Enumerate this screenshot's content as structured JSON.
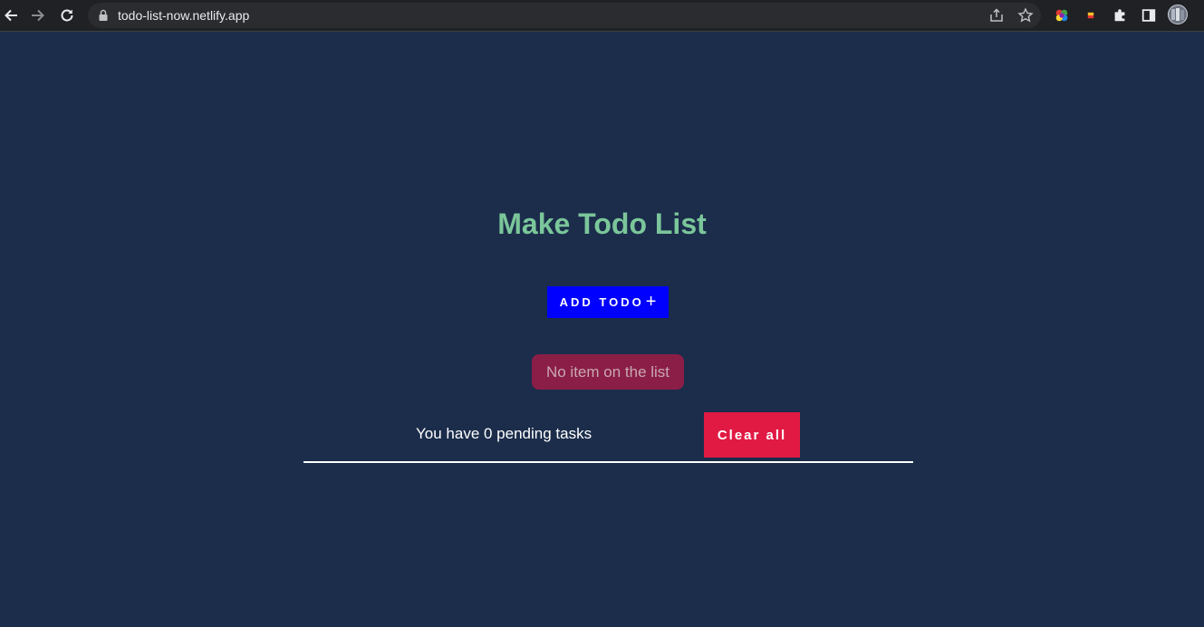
{
  "browser": {
    "url": "todo-list-now.netlify.app",
    "icons": [
      "back-arrow-icon",
      "forward-arrow-icon",
      "reload-icon",
      "lock-icon",
      "share-icon",
      "star-icon",
      "color-wheel-extension-icon",
      "extension-icon",
      "puzzle-icon",
      "side-panel-icon",
      "profile-avatar"
    ]
  },
  "app": {
    "title": "Make Todo List",
    "add_button_label": "ADD TODO",
    "add_button_icon": "+",
    "empty_message": "No item on the list",
    "pending_text": "You have 0 pending tasks",
    "clear_button_label": "Clear all"
  },
  "colors": {
    "background": "#1b2d4b",
    "title": "#7bc69a",
    "add_button": "#0000ff",
    "empty_badge": "#8b1e46",
    "clear_button": "#e11a44"
  }
}
